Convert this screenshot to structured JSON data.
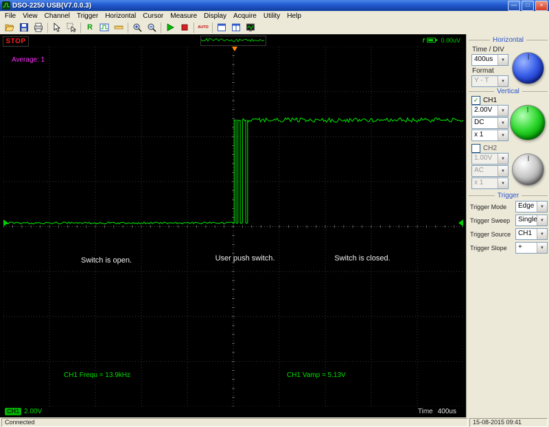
{
  "window": {
    "title": "DSO-2250 USB(V7.0.0.3)",
    "buttons": {
      "minimize": "—",
      "maximize": "□",
      "close": "×"
    },
    "status_left": "Connected",
    "status_right": "15-08-2015  09:41"
  },
  "menu": {
    "items": [
      "File",
      "View",
      "Channel",
      "Trigger",
      "Horizontal",
      "Cursor",
      "Measure",
      "Display",
      "Acquire",
      "Utility",
      "Help"
    ]
  },
  "toolbar": {
    "r_label": "R",
    "auto_label": "AUTO",
    "icons": [
      "open-icon",
      "save-icon",
      "print-icon",
      "cursor-icon",
      "select-icon",
      "refresh-r-icon",
      "measure-icon",
      "ruler-icon",
      "zoom-in-icon",
      "zoom-out-icon",
      "start-icon",
      "stop-icon",
      "auto-setup",
      "window-single-icon",
      "window-split-icon",
      "display-mode-icon"
    ]
  },
  "ui": {
    "dropdown_arrow": "▼",
    "checkmark": "✓"
  },
  "scope": {
    "run_state": "STOP",
    "hud": {
      "f_label": "f",
      "value": "0.00uV"
    },
    "average_label": "Average: 1",
    "annotations": [
      "Switch is open.",
      "User push switch.",
      "Switch is closed."
    ],
    "measurements": {
      "freq": "CH1 Frequ = 13.9kHz",
      "vamp": "CH1 Vamp = 5.13V"
    },
    "bottom": {
      "ch1_label": "CH1",
      "ch1_scale": "2.00V",
      "time_label": "Time",
      "time_value": "400us"
    }
  },
  "panel": {
    "horizontal": {
      "title": "Horizontal",
      "time_div_label": "Time / DIV",
      "time_div_value": "400us",
      "format_label": "Format",
      "format_value": "Y - T"
    },
    "vertical": {
      "title": "Vertical",
      "ch1": {
        "label": "CH1",
        "volt": "2.00V",
        "coupling": "DC",
        "probe": "x 1"
      },
      "ch2": {
        "label": "CH2",
        "volt": "1.00V",
        "coupling": "AC",
        "probe": "x 1"
      }
    },
    "trigger": {
      "title": "Trigger",
      "rows": [
        {
          "label": "Trigger Mode",
          "value": "Edge"
        },
        {
          "label": "Trigger Sweep",
          "value": "Single"
        },
        {
          "label": "Trigger Source",
          "value": "CH1"
        },
        {
          "label": "Trigger Slope",
          "value": "+"
        }
      ]
    }
  },
  "waveform": {
    "color": "#00f000",
    "low_frac": 0.49,
    "high_frac": 0.204,
    "noise_low": 1.4,
    "noise_high": 3.2,
    "trigger_frac": 0.503,
    "segments": [
      {
        "from": 0,
        "to": 0.502,
        "level": "low"
      },
      {
        "from": 0.502,
        "to": 0.506,
        "level": "high"
      },
      {
        "from": 0.506,
        "to": 0.51,
        "level": "low"
      },
      {
        "from": 0.51,
        "to": 0.515,
        "level": "high"
      },
      {
        "from": 0.515,
        "to": 0.52,
        "level": "low"
      },
      {
        "from": 0.52,
        "to": 0.527,
        "level": "high"
      },
      {
        "from": 0.527,
        "to": 0.531,
        "level": "low"
      },
      {
        "from": 0.531,
        "to": 1.0,
        "level": "high"
      }
    ]
  }
}
